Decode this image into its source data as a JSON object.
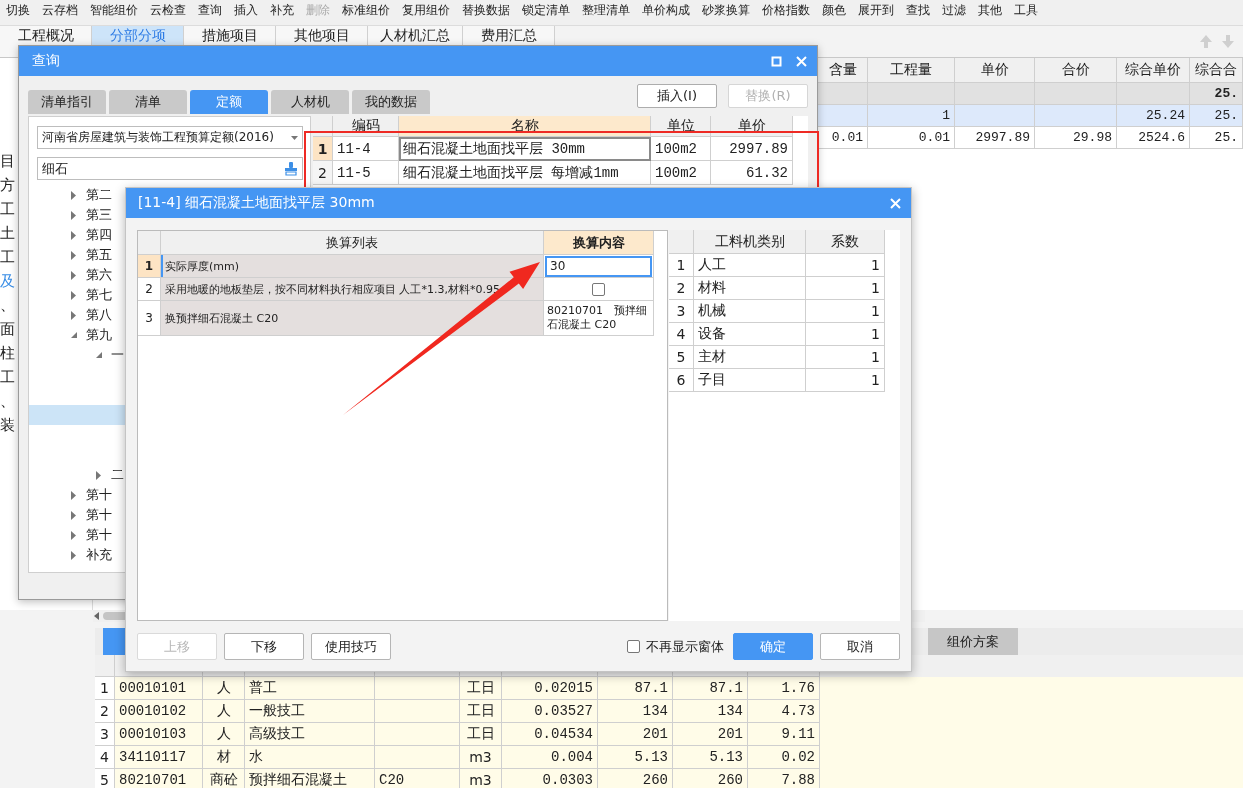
{
  "toolbar": [
    {
      "label": "切换",
      "disabled": false
    },
    {
      "label": "云存档",
      "disabled": false
    },
    {
      "label": "智能组价",
      "disabled": false
    },
    {
      "label": "云检查",
      "disabled": false
    },
    {
      "label": "查询",
      "disabled": false
    },
    {
      "label": "插入",
      "disabled": false
    },
    {
      "label": "补充",
      "disabled": false
    },
    {
      "label": "删除",
      "disabled": true
    },
    {
      "label": "标准组价",
      "disabled": false
    },
    {
      "label": "复用组价",
      "disabled": false
    },
    {
      "label": "替换数据",
      "disabled": false
    },
    {
      "label": "锁定清单",
      "disabled": false
    },
    {
      "label": "整理清单",
      "disabled": false
    },
    {
      "label": "单价构成",
      "disabled": false
    },
    {
      "label": "砂浆换算",
      "disabled": false
    },
    {
      "label": "价格指数",
      "disabled": false
    },
    {
      "label": "颜色",
      "disabled": false
    },
    {
      "label": "展开到",
      "disabled": false
    },
    {
      "label": "查找",
      "disabled": false
    },
    {
      "label": "过滤",
      "disabled": false
    },
    {
      "label": "其他",
      "disabled": false
    },
    {
      "label": "工具",
      "disabled": false
    }
  ],
  "main_tabs": [
    {
      "label": "工程概况",
      "selected": false
    },
    {
      "label": "分部分项",
      "selected": true
    },
    {
      "label": "措施项目",
      "selected": false
    },
    {
      "label": "其他项目",
      "selected": false
    },
    {
      "label": "人材机汇总",
      "selected": false
    },
    {
      "label": "费用汇总",
      "selected": false
    }
  ],
  "side_items": [
    {
      "label": "目",
      "selected": false
    },
    {
      "label": "方",
      "selected": false
    },
    {
      "label": "工",
      "selected": false
    },
    {
      "label": "土",
      "selected": false
    },
    {
      "label": "工",
      "selected": false
    },
    {
      "label": "及",
      "selected": true
    },
    {
      "label": "、",
      "selected": false
    },
    {
      "label": "面",
      "selected": false
    },
    {
      "label": "柱",
      "selected": false
    },
    {
      "label": "工",
      "selected": false
    },
    {
      "label": "、",
      "selected": false
    },
    {
      "label": "装",
      "selected": false
    }
  ],
  "project_table": {
    "columns": [
      "含量",
      "工程量",
      "单价",
      "合价",
      "综合单价",
      "综合合"
    ],
    "rows": [
      {
        "kind": "summary",
        "cells": [
          null,
          null,
          null,
          null,
          null,
          "25."
        ]
      },
      {
        "kind": "selected",
        "cells": [
          null,
          "1",
          null,
          null,
          "25.24",
          "25."
        ]
      },
      {
        "kind": "normal",
        "cells": [
          "0.01",
          "0.01",
          "2997.89",
          "29.98",
          "2524.6",
          "25."
        ]
      }
    ]
  },
  "bottom_tabs": [
    {
      "selected": true
    },
    {
      "label": "组价方案",
      "selected": false
    }
  ],
  "resource_table": {
    "rows": [
      {
        "cells": [
          "1",
          "00010101",
          "人",
          "普工",
          null,
          "工日",
          "0.02015",
          "87.1",
          "87.1",
          "1.76"
        ]
      },
      {
        "cells": [
          "2",
          "00010102",
          "人",
          "一般技工",
          null,
          "工日",
          "0.03527",
          "134",
          "134",
          "4.73"
        ]
      },
      {
        "cells": [
          "3",
          "00010103",
          "人",
          "高级技工",
          null,
          "工日",
          "0.04534",
          "201",
          "201",
          "9.11"
        ]
      },
      {
        "cells": [
          "4",
          "34110117",
          "材",
          "水",
          null,
          "m3",
          "0.004",
          "5.13",
          "5.13",
          "0.02"
        ]
      },
      {
        "cells": [
          "5",
          "80210701",
          "商砼",
          "预拌细石混凝土",
          "C20",
          "m3",
          "0.0303",
          "260",
          "260",
          "7.88"
        ]
      }
    ]
  },
  "query_dialog": {
    "title": "查询",
    "tabs": [
      {
        "label": "清单指引",
        "selected": false
      },
      {
        "label": "清单",
        "selected": false
      },
      {
        "label": "定额",
        "selected": true
      },
      {
        "label": "人材机",
        "selected": false
      },
      {
        "label": "我的数据",
        "selected": false
      }
    ],
    "buttons": [
      {
        "label": "插入(I)",
        "disabled": false
      },
      {
        "label": "替换(R)",
        "disabled": true
      }
    ],
    "quota_library": "河南省房屋建筑与装饰工程预算定额(2016)",
    "search_value": "细石",
    "tree": [
      {
        "label": "第二",
        "expanded": false
      },
      {
        "label": "第三",
        "expanded": false
      },
      {
        "label": "第四",
        "expanded": false
      },
      {
        "label": "第五",
        "expanded": false
      },
      {
        "label": "第六",
        "expanded": false
      },
      {
        "label": "第七",
        "expanded": false
      },
      {
        "label": "第八",
        "expanded": false
      },
      {
        "label": "第九",
        "expanded": true,
        "children": [
          {
            "label": "一",
            "expanded": true,
            "children": [
              {
                "selected": false
              },
              {
                "selected": false
              },
              {
                "selected": true
              },
              {
                "selected": false
              },
              {
                "selected": false
              }
            ]
          },
          {
            "label": "二",
            "expanded": false
          }
        ]
      },
      {
        "label": "第十",
        "expanded": false
      },
      {
        "label": "第十",
        "expanded": false
      },
      {
        "label": "第十",
        "expanded": false
      },
      {
        "label": "补充",
        "expanded": false
      }
    ],
    "results": {
      "columns": [
        "编码",
        "名称",
        "单位",
        "单价"
      ],
      "rows": [
        {
          "number": "1",
          "cells": [
            "11-4",
            "细石混凝土地面找平层 30mm",
            "100m2",
            "2997.89"
          ],
          "selected": true
        },
        {
          "number": "2",
          "cells": [
            "11-5",
            "细石混凝土地面找平层 每增减1mm",
            "100m2",
            "61.32"
          ],
          "selected": false
        }
      ]
    }
  },
  "conversion_dialog": {
    "title": "[11-4] 细石混凝土地面找平层 30mm",
    "list_columns": [
      "换算列表",
      "换算内容"
    ],
    "rows": [
      {
        "number": "1",
        "item": "实际厚度(mm)",
        "kind": "input",
        "value": "30",
        "selected": true
      },
      {
        "number": "2",
        "item": "采用地暖的地板垫层，按不同材料执行相应项目 人工*1.3,材料*0.95",
        "kind": "checkbox",
        "checked": false,
        "selected": false
      },
      {
        "number": "3",
        "item": "换预拌细石混凝土 C20",
        "kind": "text",
        "value": "80210701　预拌细石混凝土 C20",
        "selected": false
      }
    ],
    "factor_columns": [
      "工料机类别",
      "系数"
    ],
    "factors": [
      {
        "number": "1",
        "category": "人工",
        "factor": "1"
      },
      {
        "number": "2",
        "category": "材料",
        "factor": "1"
      },
      {
        "number": "3",
        "category": "机械",
        "factor": "1"
      },
      {
        "number": "4",
        "category": "设备",
        "factor": "1"
      },
      {
        "number": "5",
        "category": "主材",
        "factor": "1"
      },
      {
        "number": "6",
        "category": "子目",
        "factor": "1"
      }
    ],
    "left_buttons": [
      {
        "label": "上移",
        "disabled": true
      },
      {
        "label": "下移",
        "disabled": false
      },
      {
        "label": "使用技巧",
        "disabled": false
      }
    ],
    "dont_show": {
      "label": "不再显示窗体",
      "checked": false
    },
    "right_buttons": [
      {
        "label": "确定",
        "kind": "primary"
      },
      {
        "label": "取消",
        "kind": "normal"
      }
    ]
  }
}
